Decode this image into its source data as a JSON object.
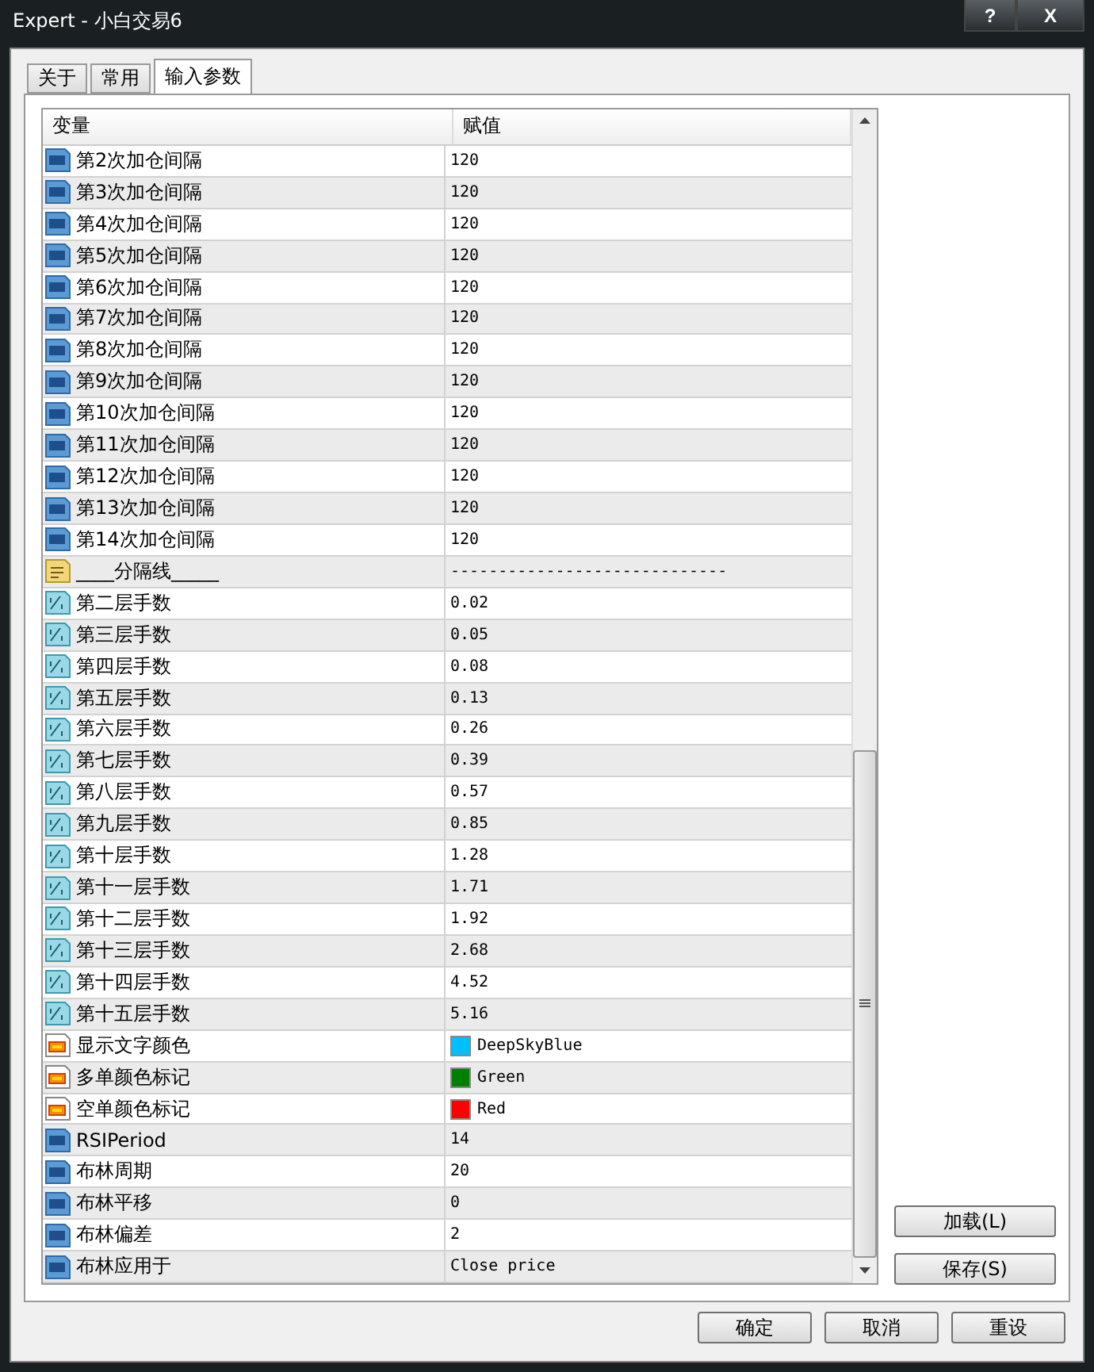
{
  "window": {
    "title": "Expert - 小白交易6",
    "buttons": [
      "?",
      "X"
    ]
  },
  "tabs": [
    {
      "label": "关于",
      "selected": false
    },
    {
      "label": "常用",
      "selected": false
    },
    {
      "label": "输入参数",
      "selected": true
    }
  ],
  "table": {
    "columns": [
      "变量",
      "赋值"
    ],
    "rows": [
      {
        "kind": "int",
        "name": "第2次加仓间隔",
        "value": "120"
      },
      {
        "kind": "int",
        "name": "第3次加仓间隔",
        "value": "120"
      },
      {
        "kind": "int",
        "name": "第4次加仓间隔",
        "value": "120"
      },
      {
        "kind": "int",
        "name": "第5次加仓间隔",
        "value": "120"
      },
      {
        "kind": "int",
        "name": "第6次加仓间隔",
        "value": "120"
      },
      {
        "kind": "int",
        "name": "第7次加仓间隔",
        "value": "120"
      },
      {
        "kind": "int",
        "name": "第8次加仓间隔",
        "value": "120"
      },
      {
        "kind": "int",
        "name": "第9次加仓间隔",
        "value": "120"
      },
      {
        "kind": "int",
        "name": "第10次加仓间隔",
        "value": "120"
      },
      {
        "kind": "int",
        "name": "第11次加仓间隔",
        "value": "120"
      },
      {
        "kind": "int",
        "name": "第12次加仓间隔",
        "value": "120"
      },
      {
        "kind": "int",
        "name": "第13次加仓间隔",
        "value": "120"
      },
      {
        "kind": "int",
        "name": "第14次加仓间隔",
        "value": "120"
      },
      {
        "kind": "string",
        "name": "____分隔线_____",
        "value": "-----------------------------"
      },
      {
        "kind": "double",
        "name": "第二层手数",
        "value": "0.02"
      },
      {
        "kind": "double",
        "name": "第三层手数",
        "value": "0.05"
      },
      {
        "kind": "double",
        "name": "第四层手数",
        "value": "0.08"
      },
      {
        "kind": "double",
        "name": "第五层手数",
        "value": "0.13"
      },
      {
        "kind": "double",
        "name": "第六层手数",
        "value": "0.26"
      },
      {
        "kind": "double",
        "name": "第七层手数",
        "value": "0.39"
      },
      {
        "kind": "double",
        "name": "第八层手数",
        "value": "0.57"
      },
      {
        "kind": "double",
        "name": "第九层手数",
        "value": "0.85"
      },
      {
        "kind": "double",
        "name": "第十层手数",
        "value": "1.28"
      },
      {
        "kind": "double",
        "name": "第十一层手数",
        "value": "1.71"
      },
      {
        "kind": "double",
        "name": "第十二层手数",
        "value": "1.92"
      },
      {
        "kind": "double",
        "name": "第十三层手数",
        "value": "2.68"
      },
      {
        "kind": "double",
        "name": "第十四层手数",
        "value": "4.52"
      },
      {
        "kind": "double",
        "name": "第十五层手数",
        "value": "5.16"
      },
      {
        "kind": "color",
        "name": "显示文字颜色",
        "value": "DeepSkyBlue",
        "color": "#00bfff"
      },
      {
        "kind": "color",
        "name": "多单颜色标记",
        "value": "Green",
        "color": "#008000"
      },
      {
        "kind": "color",
        "name": "空单颜色标记",
        "value": "Red",
        "color": "#ff0000"
      },
      {
        "kind": "int",
        "name": "RSIPeriod",
        "value": "14"
      },
      {
        "kind": "int",
        "name": "布林周期",
        "value": "20"
      },
      {
        "kind": "int",
        "name": "布林平移",
        "value": "0"
      },
      {
        "kind": "int",
        "name": "布林偏差",
        "value": "2"
      },
      {
        "kind": "int",
        "name": "布林应用于",
        "value": "Close price"
      }
    ]
  },
  "side_buttons": [
    "加载(L)",
    "保存(S)"
  ],
  "footer_buttons": [
    "确定",
    "取消",
    "重设"
  ]
}
